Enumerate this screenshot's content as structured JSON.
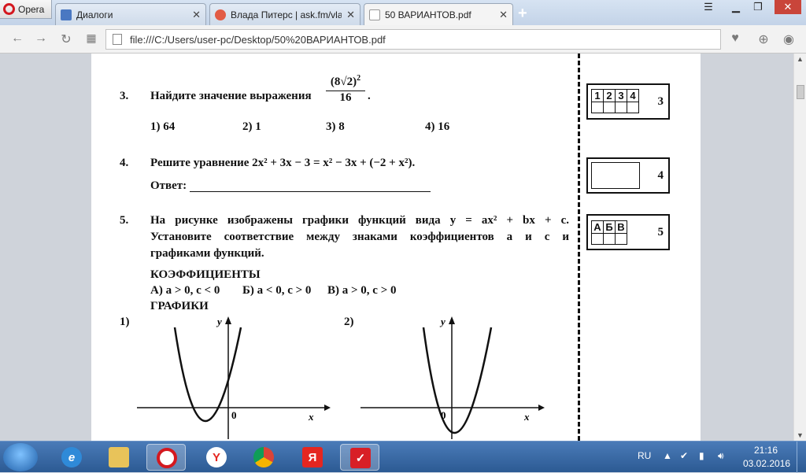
{
  "browser": {
    "menu_label": "Opera",
    "tabs": [
      {
        "label": "Диалоги",
        "fav": "#4a78c2"
      },
      {
        "label": "Влада Питерс | ask.fm/vla",
        "fav": "#e25b45"
      },
      {
        "label": "50 ВАРИАНТОВ.pdf",
        "fav": "#ffffff"
      }
    ],
    "new_tab": "+",
    "address": "file:///C:/Users/user-pc/Desktop/50%20ВАРИАНТОВ.pdf"
  },
  "doc": {
    "q3": {
      "num": "3.",
      "text": "Найдите значение выражения",
      "numerator": "(8√2)",
      "exp": "2",
      "denominator": "16",
      "period": ".",
      "options": [
        "1) 64",
        "2) 1",
        "3) 8",
        "4) 16"
      ]
    },
    "q4": {
      "num": "4.",
      "text": "Решите уравнение 2x² + 3x − 3 = x² − 3x + (−2 + x²).",
      "answer_label": "Ответ:"
    },
    "q5": {
      "num": "5.",
      "line1": "На рисунке изображены графики функций вида y = ax² + bx + c.",
      "line2": "Установите соответствие между знаками коэффициентов a и c и",
      "line3": "графиками функций.",
      "coef_header": "КОЭФФИЦИЕНТЫ",
      "coef_a": "А) a > 0, c < 0",
      "coef_b": "Б) a < 0, c > 0",
      "coef_c": "В) a > 0, c > 0",
      "graphs_header": "ГРАФИКИ",
      "graph1_label": "1)",
      "graph2_label": "2)",
      "axis_y": "y",
      "axis_x": "x",
      "origin": "0"
    },
    "answer_boxes": {
      "box3": {
        "cells": [
          "1",
          "2",
          "3",
          "4"
        ],
        "num": "3"
      },
      "box4": {
        "num": "4"
      },
      "box5": {
        "cells": [
          "А",
          "Б",
          "В"
        ],
        "num": "5"
      }
    }
  },
  "taskbar": {
    "lang": "RU",
    "time": "21:16",
    "date": "03.02.2016"
  }
}
